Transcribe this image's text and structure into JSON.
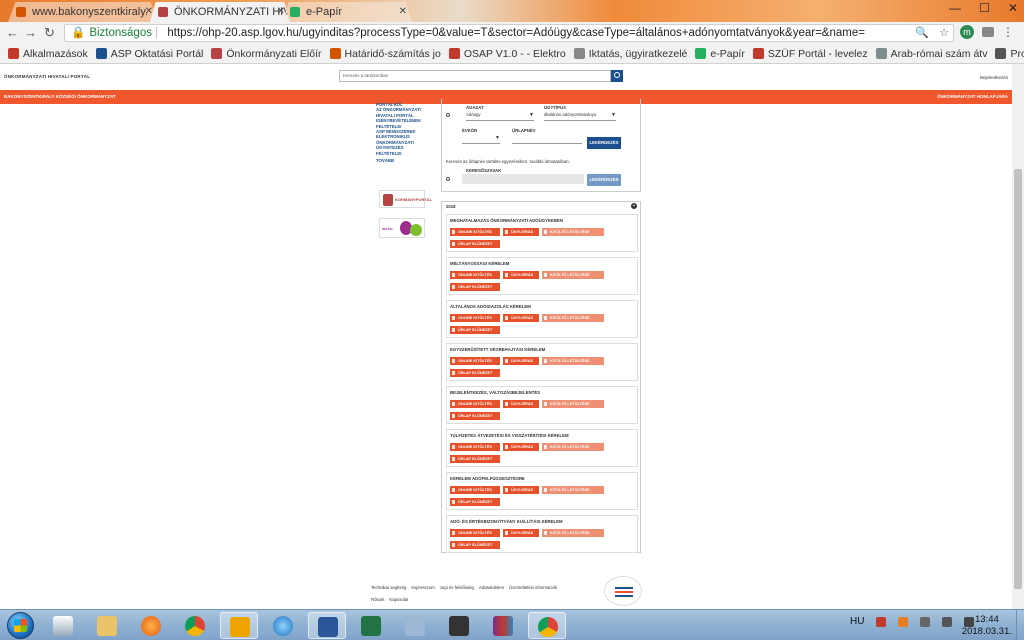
{
  "browser": {
    "tabs": [
      {
        "label": "www.bakonyszentkiraly.",
        "active": false
      },
      {
        "label": "ÖNKORMÁNYZATI HIVA",
        "active": true
      },
      {
        "label": "e-Papír",
        "active": false
      }
    ],
    "security_label": "Biztonságos",
    "url": "https://ohp-20.asp.lgov.hu/ugyinditas?processType=0&value=T&sector=Adóügy&caseType=általános+adónyomtatványok&year=&name=",
    "avatar_letter": "m",
    "bookmarks": [
      {
        "label": "Alkalmazások",
        "color": "#c0392b"
      },
      {
        "label": "ASP Oktatási Portál",
        "color": "#1b4f8f"
      },
      {
        "label": "Önkormányzati Előír",
        "color": "#b54343"
      },
      {
        "label": "Határidő-számítás jo",
        "color": "#d35400"
      },
      {
        "label": "OSAP V1.0 - - Elektro",
        "color": "#c0392b"
      },
      {
        "label": "Iktatás, ügyiratkezelé",
        "color": "#888888"
      },
      {
        "label": "e-Papír",
        "color": "#27ae60"
      },
      {
        "label": "SZÜF Portál - levelez",
        "color": "#c0392b"
      },
      {
        "label": "Arab-római szám átv",
        "color": "#7f8c8d"
      },
      {
        "label": "Probono",
        "color": "#555555"
      },
      {
        "label": "Google",
        "color": "#4285f4"
      }
    ]
  },
  "header": {
    "portal_title": "ÖNKORMÁNYZATI HIVATALI PORTÁL",
    "search_placeholder": "Keresés a tartalomban",
    "login": "Bejelentkezés",
    "municipality": "BAKONYSZENTKIRÁLY KÖZSÉGI ÖNKORMÁNYZAT",
    "office_link": "ÖNKORMÁNYZAT HONLAPJÁRA"
  },
  "sidebar": {
    "links": [
      "PORTÁLRÓL",
      "AZ ÖNKORMÁNYZATI",
      "HIVATALI PORTÁL",
      "IGÉNYBEVÉTELÉNEK",
      "FELTÉTELEI",
      "ASP RENDSZEREK",
      "ELEKTRONIKUS",
      "ÖNKORMÁNYZATI",
      "ÜGYINTÉZÉS",
      "FELTÉTELEI",
      "TOVÁBB"
    ],
    "logo1_text": "KORMÁNYPORTÁL",
    "logo2_text": "mo.hu"
  },
  "filter": {
    "sector_label": "ÁGAZAT",
    "sector_value": "Adóügy",
    "casetype_label": "ÜGYTÍPUS",
    "casetype_value": "általános adónyomtatványo",
    "year_label": "ÉVKÖR",
    "year_value": "",
    "name_label": "ŰRLAPNÉV",
    "search_btn": "LEKÉRDEZÉS",
    "desc_text": "Keresés az űrlapnév tartalmi egyezésében, további útmutatóban:",
    "keyword_label": "KERESŐSZAVAK",
    "search_btn2": "LEKÉRDEZÉS"
  },
  "cases": {
    "year": "2018",
    "buttons": {
      "online": "ONLINE KITÖLTÉS",
      "info": "ÜGYLEÍRÁS",
      "download": "KITÖLTŐ LETÖLTÉSE",
      "preview": "ŰRLAP ELŐNÉZET"
    },
    "items": [
      {
        "title": "MEGHATALMAZÁS ÖNKORMÁNYZATI ADÓÜGYEKBEN"
      },
      {
        "title": "MÉLTÁNYOSSÁGI KÉRELEM"
      },
      {
        "title": "ÁLTALÁNOS ADÓIGAZOLÁS KÉRELEM"
      },
      {
        "title": "EGYSZERŰSÍTETT VÉGREHAJTÁSI KÉRELEM"
      },
      {
        "title": "BEJELENTKEZÉS, VÁLTOZÁSBEJELENTÉS"
      },
      {
        "title": "TÚLFIZETÉS ÁTVEZETÉSI ÉS VISSZATÉRÍTÉSI KÉRELEM"
      },
      {
        "title": "KÉRELEM ADÓFELFÜGGESZTÉSRE"
      },
      {
        "title": "ADÓ- ÉS ÉRTÉKBIZONYÍTVÁNY KIÁLLÍTÁSI KÉRELEM"
      }
    ]
  },
  "footer": {
    "links": [
      "Technikai segítség",
      "Impresszum",
      "Jogi és felelősség",
      "Adatvédelem",
      "Üzemeltetési információk",
      "Rólunk",
      "Kapcsolat"
    ]
  },
  "taskbar": {
    "language": "HU",
    "time": "13:44",
    "date": "2018.03.31."
  }
}
